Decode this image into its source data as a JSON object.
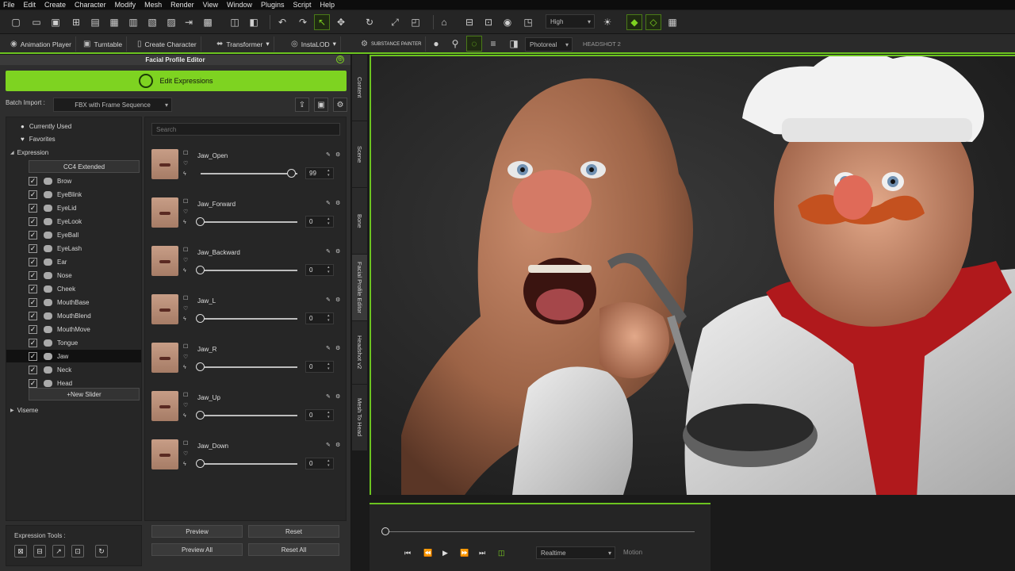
{
  "menu": [
    "File",
    "Edit",
    "Create",
    "Character",
    "Modify",
    "Mesh",
    "Render",
    "View",
    "Window",
    "Plugins",
    "Script",
    "Help"
  ],
  "toolbar": {
    "quality_value": "High",
    "render_value": "Photoreal",
    "headshot_label": "HEADSHOT 2"
  },
  "toolbar2": {
    "animation_player": "Animation Player",
    "turntable": "Turntable",
    "create_character": "Create Character",
    "transformer": "Transformer",
    "instalod": "InstaLOD",
    "substance": "SUBSTANCE PAINTER"
  },
  "panel": {
    "title": "Facial Profile Editor",
    "edit_expressions": "Edit Expressions",
    "batch_import_label": "Batch Import :",
    "batch_import_value": "FBX with Frame Sequence"
  },
  "tree": {
    "currently_used": "Currently Used",
    "favorites": "Favorites",
    "expression": "Expression",
    "cc4_extended": "CC4 Extended",
    "items": [
      "Brow",
      "EyeBlink",
      "EyeLid",
      "EyeLook",
      "EyeBall",
      "EyeLash",
      "Ear",
      "Nose",
      "Cheek",
      "MouthBase",
      "MouthBlend",
      "MouthMove",
      "Tongue",
      "Jaw",
      "Neck",
      "Head"
    ],
    "selected": "Jaw",
    "new_slider": "New Slider",
    "viseme": "Viseme"
  },
  "search": {
    "placeholder": "Search"
  },
  "sliders": [
    {
      "name": "Jaw_Open",
      "value": "99",
      "level": 0.99
    },
    {
      "name": "Jaw_Forward",
      "value": "0",
      "level": 0
    },
    {
      "name": "Jaw_Backward",
      "value": "0",
      "level": 0
    },
    {
      "name": "Jaw_L",
      "value": "0",
      "level": 0
    },
    {
      "name": "Jaw_R",
      "value": "0",
      "level": 0
    },
    {
      "name": "Jaw_Up",
      "value": "0",
      "level": 0
    },
    {
      "name": "Jaw_Down",
      "value": "0",
      "level": 0
    }
  ],
  "expression_tools": {
    "label": "Expression Tools :"
  },
  "buttons": {
    "preview": "Preview",
    "reset": "Reset",
    "preview_all": "Preview All",
    "reset_all": "Reset All"
  },
  "side_tabs": [
    "Content",
    "Scene",
    "Bone",
    "Facial Profile Editor",
    "Headshot v2",
    "Mesh To Head"
  ],
  "playback": {
    "mode": "Realtime",
    "motion": "Motion"
  },
  "colors": {
    "accent": "#7ed321",
    "panel_bg": "#2e2e2e"
  }
}
